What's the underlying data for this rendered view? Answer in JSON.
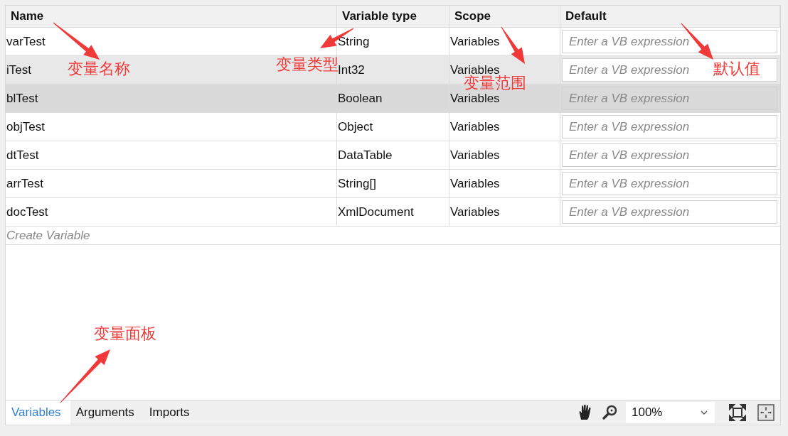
{
  "table": {
    "columns": [
      "Name",
      "Variable type",
      "Scope",
      "Default"
    ],
    "rows": [
      {
        "name": "varTest",
        "type": "String",
        "scope": "Variables",
        "default_placeholder": "Enter a VB expression",
        "selected": false,
        "hovered": false
      },
      {
        "name": "iTest",
        "type": "Int32",
        "scope": "Variables",
        "default_placeholder": "Enter a VB expression",
        "selected": false,
        "hovered": true
      },
      {
        "name": "blTest",
        "type": "Boolean",
        "scope": "Variables",
        "default_placeholder": "Enter a VB expression",
        "selected": true,
        "hovered": false
      },
      {
        "name": "objTest",
        "type": "Object",
        "scope": "Variables",
        "default_placeholder": "Enter a VB expression",
        "selected": false,
        "hovered": false
      },
      {
        "name": "dtTest",
        "type": "DataTable",
        "scope": "Variables",
        "default_placeholder": "Enter a VB expression",
        "selected": false,
        "hovered": false
      },
      {
        "name": "arrTest",
        "type": "String[]",
        "scope": "Variables",
        "default_placeholder": "Enter a VB expression",
        "selected": false,
        "hovered": false
      },
      {
        "name": "docTest",
        "type": "XmlDocument",
        "scope": "Variables",
        "default_placeholder": "Enter a VB expression",
        "selected": false,
        "hovered": false
      }
    ],
    "create_row": "Create Variable"
  },
  "tabs": [
    {
      "label": "Variables",
      "selected": true
    },
    {
      "label": "Arguments",
      "selected": false
    },
    {
      "label": "Imports",
      "selected": false
    }
  ],
  "zoom": {
    "value": "100%"
  },
  "annotations": [
    {
      "text": "变量名称"
    },
    {
      "text": "变量类型"
    },
    {
      "text": "变量范围"
    },
    {
      "text": "默认值"
    },
    {
      "text": "变量面板"
    }
  ]
}
